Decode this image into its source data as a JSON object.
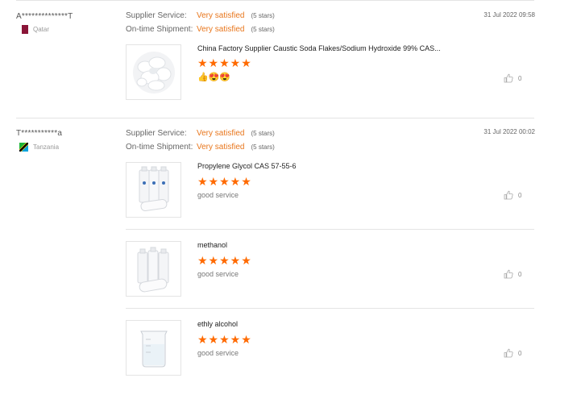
{
  "reviews": [
    {
      "user": "A**************T",
      "country": "Qatar",
      "date": "31 Jul 2022 09:58",
      "supplier_service_label": "Supplier Service:",
      "supplier_service_value": "Very satisfied",
      "supplier_service_stars": "(5 stars)",
      "ontime_label": "On-time Shipment:",
      "ontime_value": "Very satisfied",
      "ontime_stars": "(5 stars)",
      "items": [
        {
          "title": "China Factory Supplier Caustic Soda Flakes/Sodium Hydroxide 99% CAS...",
          "rating": 5,
          "stars_text": "★★★★★",
          "emoji": "👍😍😍",
          "likes": "0"
        }
      ]
    },
    {
      "user": "T***********a",
      "country": "Tanzania",
      "date": "31 Jul 2022 00:02",
      "supplier_service_label": "Supplier Service:",
      "supplier_service_value": "Very satisfied",
      "supplier_service_stars": "(5 stars)",
      "ontime_label": "On-time Shipment:",
      "ontime_value": "Very satisfied",
      "ontime_stars": "(5 stars)",
      "items": [
        {
          "title": "Propylene Glycol CAS 57-55-6",
          "rating": 5,
          "stars_text": "★★★★★",
          "comment": "good service",
          "likes": "0"
        },
        {
          "title": "methanol",
          "rating": 5,
          "stars_text": "★★★★★",
          "comment": "good service",
          "likes": "0"
        },
        {
          "title": "ethly alcohol",
          "rating": 5,
          "stars_text": "★★★★★",
          "comment": "good service",
          "likes": "0"
        }
      ]
    }
  ],
  "colors": {
    "accent": "#e8761c",
    "star": "#ff6a00",
    "divider": "#e4e4e4"
  },
  "icons": {
    "like": "thumbs-up-icon"
  }
}
